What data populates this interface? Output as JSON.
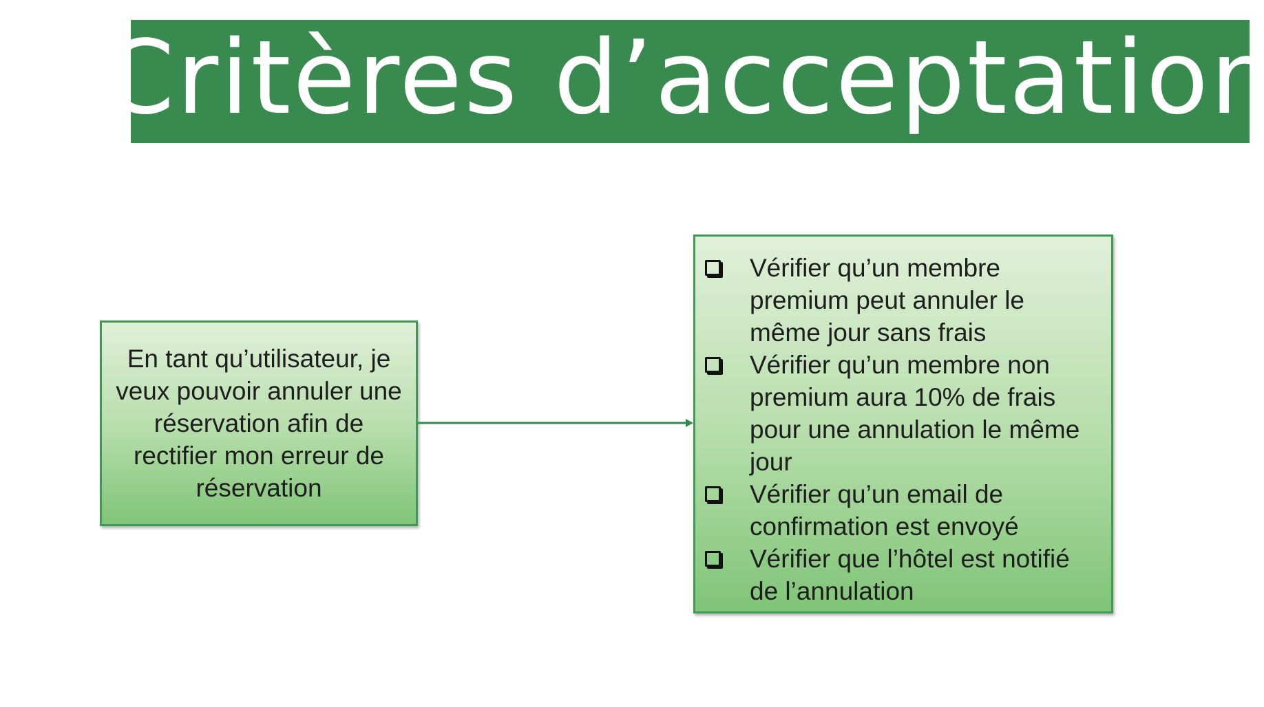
{
  "title": "Critères d’acceptation",
  "user_story": "En tant qu’utilisateur, je veux pouvoir annuler une réservation afin de rectifier mon erreur de réservation",
  "criteria": [
    {
      "text": "Vérifier qu’un membre premium peut annuler le même jour sans frais",
      "icon": "checkbox-icon"
    },
    {
      "text": "Vérifier qu’un membre non premium aura 10% de frais pour une annulation le même jour",
      "icon": "checkbox-icon"
    },
    {
      "text": "Vérifier qu’un email de confirmation est envoyé",
      "icon": "checkbox-icon"
    },
    {
      "text": "Vérifier que l’hôtel est notifié de l’annulation",
      "icon": "checkbox-icon"
    }
  ],
  "colors": {
    "banner": "#388a4f",
    "box_border": "#3f9a56",
    "arrow": "#2e8a4f"
  }
}
